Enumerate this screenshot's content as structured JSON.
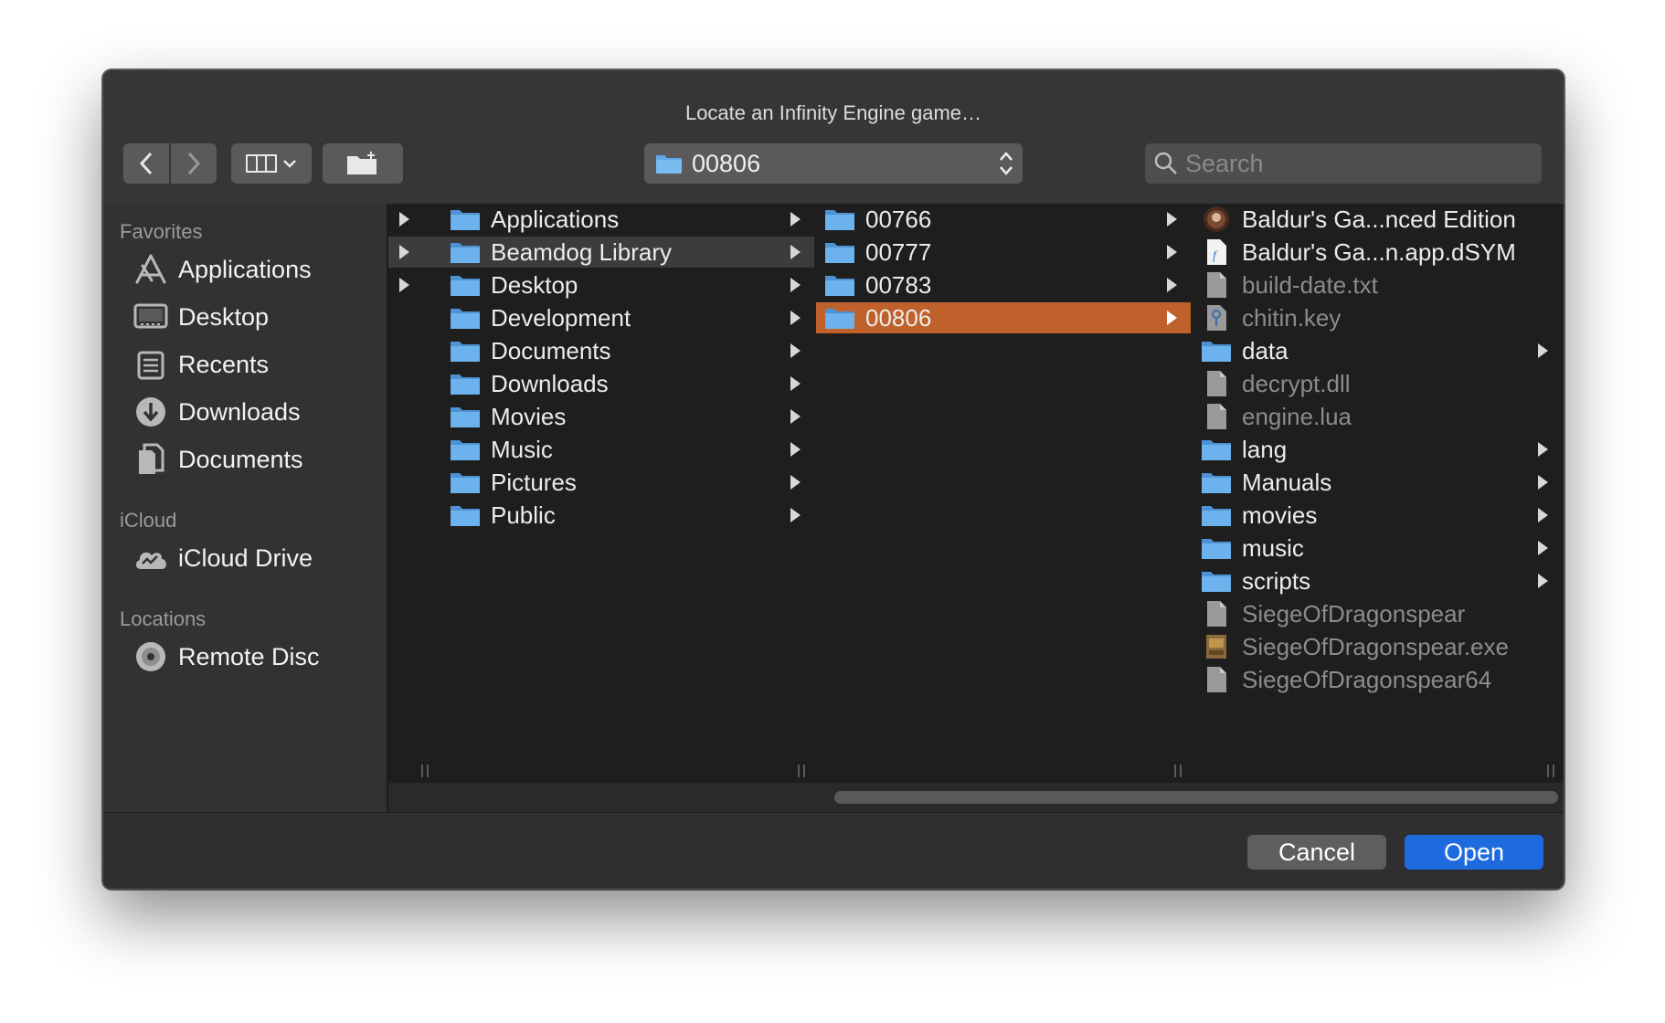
{
  "window": {
    "title": "Locate an Infinity Engine game…"
  },
  "toolbar": {
    "path_popup_label": "00806",
    "search_placeholder": "Search"
  },
  "sidebar": {
    "favorites_heading": "Favorites",
    "favorites": [
      {
        "label": "Applications",
        "icon": "applications-icon"
      },
      {
        "label": "Desktop",
        "icon": "desktop-icon"
      },
      {
        "label": "Recents",
        "icon": "recents-icon"
      },
      {
        "label": "Downloads",
        "icon": "downloads-icon"
      },
      {
        "label": "Documents",
        "icon": "documents-icon"
      }
    ],
    "icloud_heading": "iCloud",
    "icloud": [
      {
        "label": "iCloud Drive",
        "icon": "icloud-drive-icon"
      }
    ],
    "locations_heading": "Locations",
    "locations": [
      {
        "label": "Remote Disc",
        "icon": "remote-disc-icon"
      }
    ]
  },
  "columns": {
    "col2": [
      {
        "label": "Applications"
      },
      {
        "label": "Beamdog Library",
        "selected": true
      },
      {
        "label": "Desktop"
      },
      {
        "label": "Development"
      },
      {
        "label": "Documents"
      },
      {
        "label": "Downloads"
      },
      {
        "label": "Movies"
      },
      {
        "label": "Music"
      },
      {
        "label": "Pictures"
      },
      {
        "label": "Public"
      }
    ],
    "col3": [
      {
        "label": "00766"
      },
      {
        "label": "00777"
      },
      {
        "label": "00783"
      },
      {
        "label": "00806",
        "selected": true
      }
    ],
    "col4": [
      {
        "label": "Baldur's Ga...nced Edition",
        "kind": "app"
      },
      {
        "label": "Baldur's Ga...n.app.dSYM",
        "kind": "dsym"
      },
      {
        "label": "build-date.txt",
        "kind": "file",
        "dim": true
      },
      {
        "label": "chitin.key",
        "kind": "key",
        "dim": true
      },
      {
        "label": "data",
        "kind": "folder"
      },
      {
        "label": "decrypt.dll",
        "kind": "file",
        "dim": true
      },
      {
        "label": "engine.lua",
        "kind": "file",
        "dim": true
      },
      {
        "label": "lang",
        "kind": "folder"
      },
      {
        "label": "Manuals",
        "kind": "folder"
      },
      {
        "label": "movies",
        "kind": "folder"
      },
      {
        "label": "music",
        "kind": "folder"
      },
      {
        "label": "scripts",
        "kind": "folder"
      },
      {
        "label": "SiegeOfDragonspear",
        "kind": "file",
        "dim": true
      },
      {
        "label": "SiegeOfDragonspear.exe",
        "kind": "exe",
        "dim": true
      },
      {
        "label": "SiegeOfDragonspear64",
        "kind": "file",
        "dim": true
      }
    ]
  },
  "footer": {
    "cancel_label": "Cancel",
    "open_label": "Open"
  },
  "colors": {
    "selection_orange": "#c0612b",
    "primary_blue": "#1e6be0",
    "folder_blue": "#62a8e5"
  }
}
